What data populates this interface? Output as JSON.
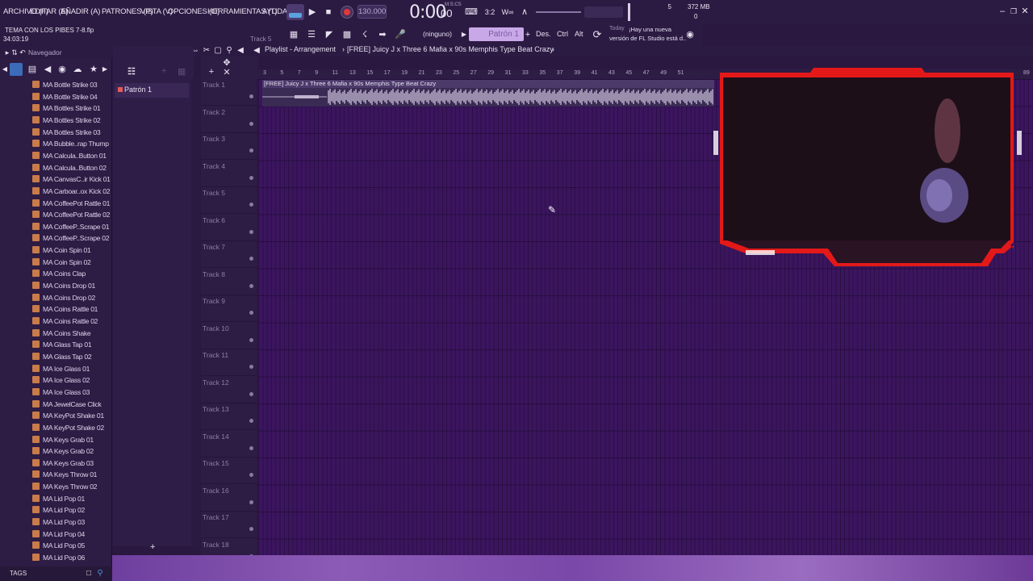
{
  "menubar": {
    "items": [
      "ARCHIVO (F)",
      "EDITAR (E)",
      "AÑADIR (A)",
      "PATRONES (P)",
      "VISTA (V)",
      "OPCIONES (O)",
      "HERRAMIENTAS (T)",
      "AYUDA"
    ],
    "tempo": "130.000",
    "time": "0:00",
    "time_small": "00",
    "time_units": "M:S:CS",
    "cpu_value": "5",
    "memory": "372 MB",
    "poly_value": "0"
  },
  "project": {
    "name": "TEMA CON LOS PIBES 7-8.flp",
    "elapsed": "34:03:19",
    "hint_track": "Track 5"
  },
  "toolbar": {
    "snap": "(ninguno)",
    "pattern": "Patrón 1",
    "des": "Des.",
    "ctrl": "Ctrl",
    "alt": "Alt",
    "news_today": "Today",
    "news_line1": "¡Hay una nueva",
    "news_line2": "versión de FL Studio está d.."
  },
  "browser": {
    "title": "Navegador",
    "tags_label": "TAGS",
    "items": [
      "MA Bottle Strike 03",
      "MA Bottle Strike 04",
      "MA Bottles Strike 01",
      "MA Bottles Strike 02",
      "MA Bottles Strike 03",
      "MA Bubble..rap Thump",
      "MA Calcula..Button 01",
      "MA Calcula..Button 02",
      "MA CanvasC..ir Kick 01",
      "MA Carboar..ox Kick 02",
      "MA CoffeePot Rattle 01",
      "MA CoffeePot Rattle 02",
      "MA CoffeeP..Scrape 01",
      "MA CoffeeP..Scrape 02",
      "MA Coin Spin 01",
      "MA Coin Spin 02",
      "MA Coins Clap",
      "MA Coins Drop 01",
      "MA Coins Drop 02",
      "MA Coins Rattle 01",
      "MA Coins Rattle 02",
      "MA Coins Shake",
      "MA Glass Tap 01",
      "MA Glass Tap 02",
      "MA Ice Glass 01",
      "MA Ice Glass 02",
      "MA Ice Glass 03",
      "MA JewelCase Click",
      "MA KeyPot Shake 01",
      "MA KeyPot Shake 02",
      "MA Keys Grab 01",
      "MA Keys Grab 02",
      "MA Keys Grab 03",
      "MA Keys Throw 01",
      "MA Keys Throw 02",
      "MA Lid Pop 01",
      "MA Lid Pop 02",
      "MA Lid Pop 03",
      "MA Lid Pop 04",
      "MA Lid Pop 05",
      "MA Lid Pop 06"
    ]
  },
  "patterns": {
    "items": [
      "Patrón 1"
    ],
    "add": "+"
  },
  "playlist": {
    "title": "Playlist - Arrangement",
    "breadcrumb": "[FREE] Juicy J x Three 6 Mafia x 90s Memphis Type Beat Crazy",
    "clip_name": "[FREE] Juicy J x Three 6 Mafia x 90s Memphis Type Beat Crazy",
    "ruler": [
      "3",
      "5",
      "7",
      "9",
      "11",
      "13",
      "15",
      "17",
      "19",
      "21",
      "23",
      "25",
      "27",
      "29",
      "31",
      "33",
      "35",
      "37",
      "39",
      "41",
      "43",
      "45",
      "47",
      "49",
      "51"
    ],
    "ruler_end": "89",
    "tracks": [
      "Track 1",
      "Track 2",
      "Track 3",
      "Track 4",
      "Track 5",
      "Track 6",
      "Track 7",
      "Track 8",
      "Track 9",
      "Track 10",
      "Track 11",
      "Track 12",
      "Track 13",
      "Track 14",
      "Track 15",
      "Track 16",
      "Track 17",
      "Track 18"
    ]
  },
  "colors": {
    "grid": "#3b155e",
    "accent_red": "#e31919",
    "menu_bg": "#2b1b42",
    "pattern_box": "#c9a8e8"
  }
}
